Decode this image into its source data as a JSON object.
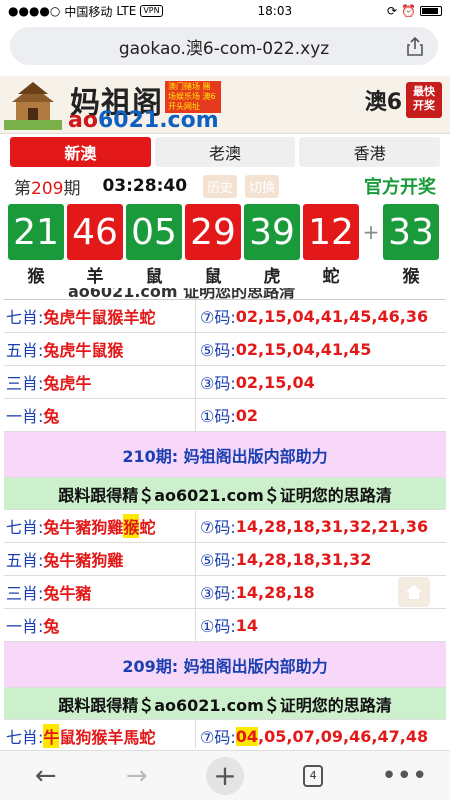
{
  "status": {
    "carrier": "中国移动",
    "network": "LTE",
    "vpn": "VPN",
    "time": "18:03"
  },
  "browser": {
    "url": "gaokao.澳6-com-022.xyz",
    "tab_count": "4"
  },
  "banner": {
    "title": "妈祖阁",
    "tagline": "澳门赌场 赌场娱乐场 澳6开头网址",
    "url_part1": "ao",
    "url_part2": "6021.com",
    "right_text": "澳6",
    "seal_text": "最快开奖"
  },
  "tabs": [
    {
      "label": "新澳",
      "active": true
    },
    {
      "label": "老澳",
      "active": false
    },
    {
      "label": "香港",
      "active": false
    }
  ],
  "draw": {
    "period_prefix": "第",
    "period_num": "209",
    "period_suffix": "期",
    "time": "03:28:40",
    "history_label": "历史",
    "switch_label": "切换",
    "official_label": "官方开奖"
  },
  "balls": [
    {
      "num": "21",
      "zodiac": "猴",
      "color": "green"
    },
    {
      "num": "46",
      "zodiac": "羊",
      "color": "red"
    },
    {
      "num": "05",
      "zodiac": "鼠",
      "color": "green"
    },
    {
      "num": "29",
      "zodiac": "鼠",
      "color": "red"
    },
    {
      "num": "39",
      "zodiac": "虎",
      "color": "green"
    },
    {
      "num": "12",
      "zodiac": "蛇",
      "color": "red"
    }
  ],
  "plus_sign": "+",
  "special_ball": {
    "num": "33",
    "zodiac": "猴",
    "color": "green"
  },
  "cutoff_text": "ao6021.com  证明您的思路清",
  "block1": [
    {
      "lab": "七肖:",
      "zod": "兔虎牛鼠猴羊蛇",
      "code_lab": "⑦码:",
      "codes": "02,15,04,41,45,46,36"
    },
    {
      "lab": "五肖:",
      "zod": "兔虎牛鼠猴",
      "code_lab": "⑤码:",
      "codes": "02,15,04,41,45"
    },
    {
      "lab": "三肖:",
      "zod": "兔虎牛",
      "code_lab": "③码:",
      "codes": "02,15,04"
    },
    {
      "lab": "一肖:",
      "zod": "兔",
      "code_lab": "①码:",
      "codes": "02"
    }
  ],
  "section210": {
    "head": "210期: 妈祖阁出版内部助力",
    "ad": "跟料跟得精＄ao6021.com＄证明您的思路清"
  },
  "block210": [
    {
      "lab": "七肖:",
      "zod_a": "兔牛豬狗雞",
      "zod_hl": "猴",
      "zod_b": "蛇",
      "code_lab": "⑦码:",
      "codes": "14,28,18,31,32,21,36"
    },
    {
      "lab": "五肖:",
      "zod": "兔牛豬狗雞",
      "code_lab": "⑤码:",
      "codes": "14,28,18,31,32"
    },
    {
      "lab": "三肖:",
      "zod": "兔牛豬",
      "code_lab": "③码:",
      "codes": "14,28,18"
    },
    {
      "lab": "一肖:",
      "zod": "兔",
      "code_lab": "①码:",
      "codes": "14"
    }
  ],
  "section209": {
    "head": "209期: 妈祖阁出版内部助力",
    "ad": "跟料跟得精＄ao6021.com＄证明您的思路清"
  },
  "row209": {
    "lab": "七肖:",
    "zod_hl": "牛",
    "zod_b": "鼠狗猴羊馬蛇",
    "code_lab": "⑦码:",
    "code_hl": "04",
    "codes_b": ",05,07,09,46,47,48"
  }
}
